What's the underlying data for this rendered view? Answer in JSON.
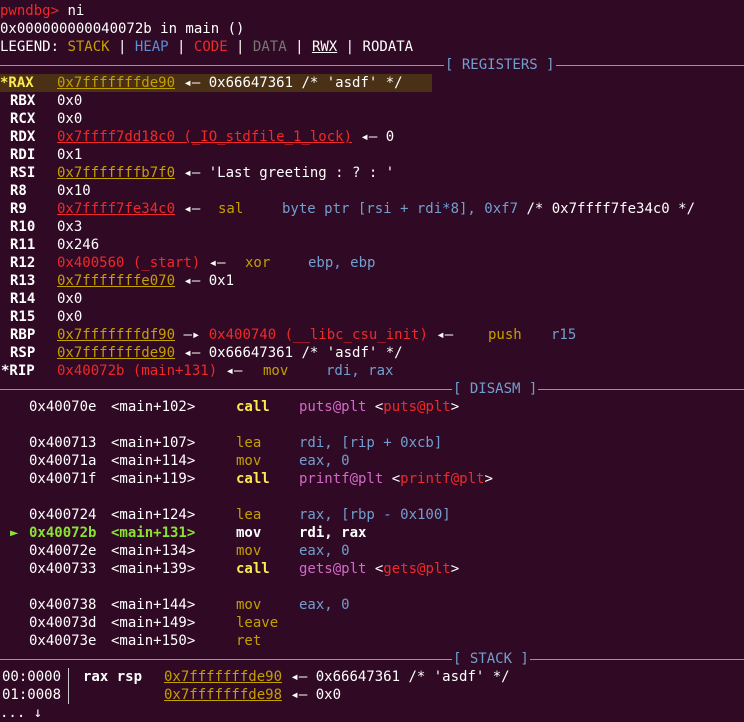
{
  "prompt": {
    "name": "pwndbg>",
    "cmd": " ni"
  },
  "location": "0x000000000040072b in main ()",
  "legend": {
    "label": "LEGEND: ",
    "stack": "STACK",
    "sep": " | ",
    "heap": "HEAP",
    "code": "CODE",
    "data": "DATA",
    "rwx": "RWX",
    "rodata": "RODATA"
  },
  "sections": {
    "registers": "[ REGISTERS ]",
    "disasm": "[ DISASM ]",
    "stack": "[ STACK ]"
  },
  "registers": {
    "rax": {
      "name": "*RAX",
      "ptr": "0x7fffffffde90",
      "arrow": " ◂— ",
      "val": "0x66647361 /* 'asdf' */"
    },
    "rbx": {
      "name": "RBX",
      "val": "0x0"
    },
    "rcx": {
      "name": "RCX",
      "val": "0x0"
    },
    "rdx": {
      "name": "RDX",
      "ptr": "0x7ffff7dd18c0 (_IO_stdfile_1_lock)",
      "arrow": " ◂— ",
      "val": "0"
    },
    "rdi": {
      "name": "RDI",
      "val": "0x1"
    },
    "rsi": {
      "name": "RSI",
      "ptr": "0x7fffffffb7f0",
      "arrow": " ◂— ",
      "val": "'Last greeting : ? : '"
    },
    "r8": {
      "name": "R8",
      "val": "0x10"
    },
    "r9": {
      "name": "R9",
      "ptr": "0x7ffff7fe34c0",
      "arrow": " ◂— ",
      "mn": "sal",
      "ops": "byte ptr [rsi + rdi*8], 0xf7",
      "comment": " /* 0x7ffff7fe34c0 */"
    },
    "r10": {
      "name": "R10",
      "val": "0x3"
    },
    "r11": {
      "name": "R11",
      "val": "0x246"
    },
    "r12": {
      "name": "R12",
      "ptr": "0x400560 (_start)",
      "arrow": " ◂— ",
      "mn": "xor",
      "ops": "ebp, ebp"
    },
    "r13": {
      "name": "R13",
      "ptr": "0x7fffffffe070",
      "arrow": " ◂— ",
      "val": "0x1"
    },
    "r14": {
      "name": "R14",
      "val": "0x0"
    },
    "r15": {
      "name": "R15",
      "val": "0x0"
    },
    "rbp": {
      "name": "RBP",
      "ptr": "0x7fffffffdf90",
      "arrow1": " —▸ ",
      "ptr2": "0x400740 (__libc_csu_init)",
      "arrow": " ◂— ",
      "mn": "push",
      "ops": "r15"
    },
    "rsp": {
      "name": "RSP",
      "ptr": "0x7fffffffde90",
      "arrow": " ◂— ",
      "val": "0x66647361 /* 'asdf' */"
    },
    "rip": {
      "name": "*RIP",
      "ptr": "0x40072b (main+131)",
      "arrow": " ◂— ",
      "mn": "mov",
      "ops": "rdi, rax"
    }
  },
  "disasm": [
    {
      "addr": "0x40070e",
      "sym": "<main+102>",
      "mn": "call",
      "ops": "puts@plt",
      "target": "puts@plt"
    },
    {
      "addr": "0x400713",
      "sym": "<main+107>",
      "mn": "lea",
      "ops": "rdi, [rip + 0xcb]"
    },
    {
      "addr": "0x40071a",
      "sym": "<main+114>",
      "mn": "mov",
      "ops": "eax, 0"
    },
    {
      "addr": "0x40071f",
      "sym": "<main+119>",
      "mn": "call",
      "ops": "printf@plt",
      "target": "printf@plt"
    },
    {
      "addr": "0x400724",
      "sym": "<main+124>",
      "mn": "lea",
      "ops": "rax, [rbp - 0x100]"
    },
    {
      "addr": "0x40072b",
      "sym": "<main+131>",
      "mn": "mov",
      "ops": "rdi, rax",
      "marker": "►"
    },
    {
      "addr": "0x40072e",
      "sym": "<main+134>",
      "mn": "mov",
      "ops": "eax, 0"
    },
    {
      "addr": "0x400733",
      "sym": "<main+139>",
      "mn": "call",
      "ops": "gets@plt",
      "target": "gets@plt"
    },
    {
      "addr": "0x400738",
      "sym": "<main+144>",
      "mn": "mov",
      "ops": "eax, 0"
    },
    {
      "addr": "0x40073d",
      "sym": "<main+149>",
      "mn": "leave",
      "ops": ""
    },
    {
      "addr": "0x40073e",
      "sym": "<main+150>",
      "mn": "ret",
      "ops": ""
    }
  ],
  "stack": [
    {
      "idx": "00:0000",
      "regs": "rax rsp",
      "ptr": "0x7fffffffde90",
      "arrow": " ◂— ",
      "val": "0x66647361 /* 'asdf' */"
    },
    {
      "idx": "01:0008",
      "regs": "",
      "ptr": "0x7fffffffde98",
      "arrow": " ◂— ",
      "val": "0x0"
    }
  ],
  "more": "... ↓"
}
